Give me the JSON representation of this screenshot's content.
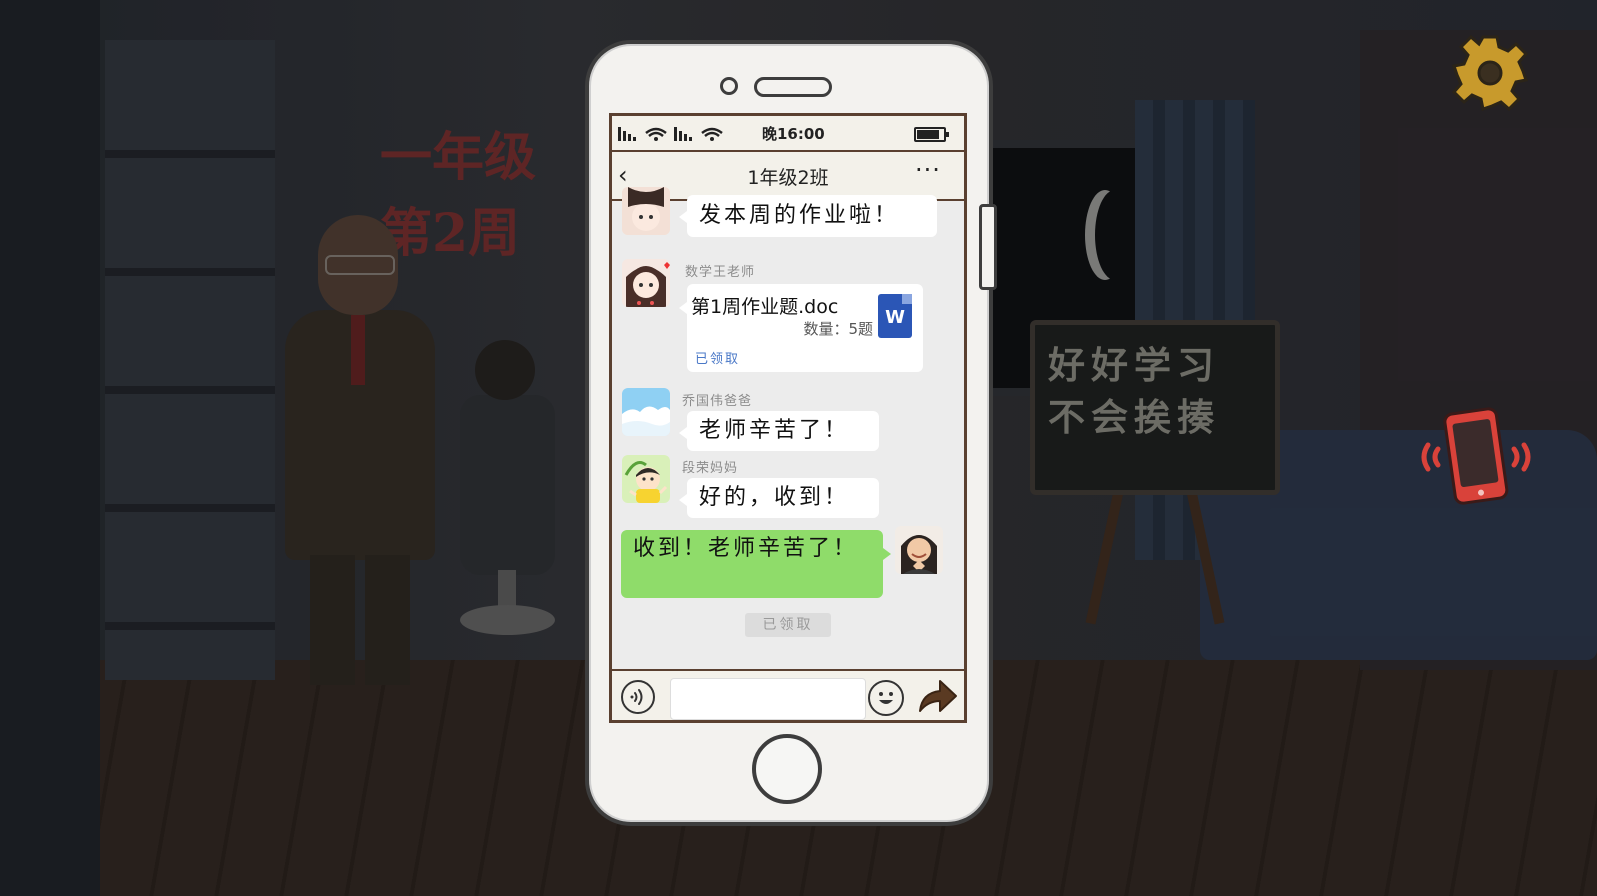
{
  "scene": {
    "banner_line1": "一年级",
    "banner_line2": "第2周",
    "blackboard_line1": "好好学习",
    "blackboard_line2": "不会挨揍"
  },
  "icons": {
    "settings": "gear-icon",
    "vibrating_phone": "vibrating-phone-icon"
  },
  "phone": {
    "status_bar": {
      "time": "晚16:00",
      "signal": "signal-icon",
      "wifi": "wifi-icon",
      "battery": "battery-icon"
    },
    "header": {
      "back": "‹",
      "title": "1年级2班",
      "more": "···"
    },
    "messages": [
      {
        "type": "text",
        "sender": "",
        "text": "发本周的作业啦！"
      },
      {
        "type": "file",
        "sender": "数学王老师",
        "file_name": "第1周作业题.doc",
        "file_count": "数量：5题",
        "file_icon": "W",
        "status": "已领取"
      },
      {
        "type": "text",
        "sender": "乔国伟爸爸",
        "text": "老师辛苦了！"
      },
      {
        "type": "text",
        "sender": "段荣妈妈",
        "text": "好的，收到！"
      },
      {
        "type": "text",
        "sender": "self",
        "text": "收到！老师辛苦了！"
      }
    ],
    "system_chip": "已领取",
    "input": {
      "value": "",
      "voice": "voice-icon",
      "emoji": "emoji-icon",
      "send": "send-arrow-icon"
    }
  },
  "colors": {
    "outgoing_bubble": "#8fdc6a",
    "incoming_bubble": "#ffffff",
    "chat_background": "#ececec",
    "file_link": "#4a78c7",
    "word_icon": "#2b56b6",
    "settings_gear": "#c89a2c",
    "vibrating_phone": "#d9423a"
  }
}
